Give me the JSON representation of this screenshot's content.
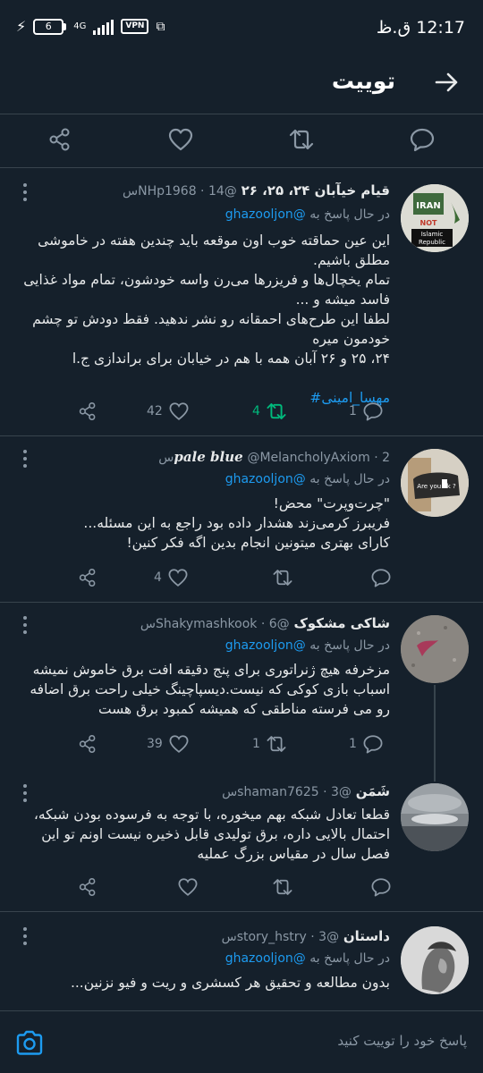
{
  "status_bar": {
    "time": "12:17 ق.ظ",
    "battery": "6",
    "network": "4G",
    "vpn": "VPN"
  },
  "header": {
    "title": "توییت",
    "back_icon": "arrow-right-icon"
  },
  "action_bar": {
    "icons": [
      "share-icon",
      "heart-icon",
      "retweet-icon",
      "reply-icon"
    ]
  },
  "tweets": [
    {
      "name": "قیام خیآبان ۲۴، ۲۵، ۲۶",
      "handle": "@NHp1968 · 14س",
      "reply_prefix": "در حال پاسخ به",
      "reply_to": "@ghazooljon",
      "body": "این عین حماقته خوب اون موقعه باید چندین هفته در خاموشی مطلق باشیم.\nتمام یخچال‌ها و فریزرها می‌رن واسه خودشون، تمام مواد غذایی فاسد میشه و ...\nلطفا این طرح‌های احمقانه رو نشر ندهید. فقط دودش تو چشم خودمون میره\n۲۴، ۲۵ و ۲۶ آبان همه با هم در خیابان برای براندازی ج.ا",
      "hashtag": "مهسا_امینی#",
      "replies": "1",
      "retweets": "4",
      "likes": "42",
      "avatar_text": [
        "IRAN",
        "NOT",
        "Islamic",
        "Republic"
      ]
    },
    {
      "name": "pale blue",
      "handle": "@MelancholyAxiom · 2س",
      "reply_prefix": "در حال پاسخ به",
      "reply_to": "@ghazooljon",
      "body": "\"چرت‌وپرت\" محض!\nفریبرز کرمی‌زند هشدار داده بود راجع به این مسئله...\nکارای بهتری میتونین انجام بدین اگه فکر کنین!",
      "replies": "",
      "retweets": "",
      "likes": "4",
      "avatar_text": [
        "Are you ok ?"
      ]
    },
    {
      "name": "شاکی مشکوک",
      "handle": "@Shakymashkook · 6س",
      "reply_prefix": "در حال پاسخ به",
      "reply_to": "@ghazooljon",
      "body": "مزخرفه هیچ ژنراتوری برای پنج دقیقه افت برق خاموش نمیشه اسباب بازی کوکی که نیست.دیسپاچینگ خیلی راحت برق اضافه رو می فرسته مناطقی که همیشه کمبود برق هست",
      "replies": "1",
      "retweets": "1",
      "likes": "39"
    },
    {
      "name": "شَمَن",
      "handle": "@shaman7625 · 3س",
      "body": "قطعا تعادل شبکه بهم میخوره، با توجه به فرسوده بودن شبکه، احتمال بالایی داره، برق تولیدی قابل ذخیره نیست اونم تو این فصل سال در مقیاس بزرگ عملیه",
      "replies": "",
      "retweets": "",
      "likes": ""
    },
    {
      "name": "داستان",
      "handle": "@story_hstry · 3س",
      "reply_prefix": "در حال پاسخ به",
      "reply_to": "@ghazooljon",
      "body": "بدون مطالعه و تحقیق هر کسشری و ریت و فیو نزنین..."
    }
  ],
  "composer": {
    "placeholder": "پاسخ خود را توییت کنید",
    "icon": "camera-icon"
  },
  "colors": {
    "background": "#15202b",
    "accent": "#1d9bf0",
    "retweet_active": "#00ba7c",
    "muted": "#8b98a5",
    "divider": "#38444d"
  }
}
